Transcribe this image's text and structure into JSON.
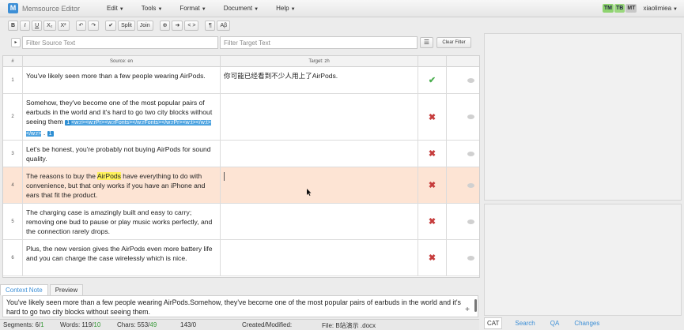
{
  "menubar": {
    "app_name": "Memsource Editor",
    "menus": [
      "Edit",
      "Tools",
      "Format",
      "Document",
      "Help"
    ],
    "badges": [
      "TM",
      "TB",
      "MT"
    ],
    "user": "xiaolimiea"
  },
  "toolbar": {
    "bold": "B",
    "italic": "I",
    "underline": "U",
    "subscript": "X₂",
    "superscript": "X²",
    "undo": "↶",
    "redo": "↷",
    "confirm": "✔",
    "split": "Split",
    "join": "Join",
    "copy_source": "⊕",
    "next": "➜",
    "tags": "< >",
    "pilcrow": "¶",
    "special_chars": "Aβ"
  },
  "filters": {
    "source_placeholder": "Filter Source Text",
    "target_placeholder": "Filter Target Text",
    "list_icon": "☰",
    "clear_label": "Clear Filter"
  },
  "grid": {
    "headers": {
      "num": "#",
      "source": "Source: en",
      "target": "Target: zh"
    },
    "rows": [
      {
        "num": "1",
        "source": "You've likely seen more than a few people wearing AirPods.",
        "target": "你可能已经看到不少人用上了AirPods.",
        "status": "confirmed"
      },
      {
        "num": "2",
        "source_before": "Somehow, they've become one of the most popular pairs of earbuds in the world and it's hard to go two city blocks without seeing them ",
        "tag_open": "1",
        "tag_text": "<w:r><w:rPr><w:rFonts></w:rFonts></w:rPr><w:t></w:t></w:r>",
        "source_after": " . ",
        "tag_close": "1",
        "target": "",
        "status": "unconfirmed"
      },
      {
        "num": "3",
        "source": "Let's be honest, you're probably not buying AirPods for sound quality.",
        "target": "",
        "status": "unconfirmed"
      },
      {
        "num": "4",
        "source_before": "The reasons to buy the ",
        "highlight": "AirPods",
        "source_after": " have everything to do with convenience, but that only works if you have an iPhone and ears that fit the product.",
        "target": "",
        "status": "unconfirmed"
      },
      {
        "num": "5",
        "source": "The charging case is amazingly built and easy to carry; removing one bud to pause or play music works perfectly, and the connection rarely drops.",
        "target": "",
        "status": "unconfirmed"
      },
      {
        "num": "6",
        "source": "Plus, the new version gives the AirPods even more battery life and you can charge the case wirelessly which is nice.",
        "target": "",
        "status": "unconfirmed"
      }
    ]
  },
  "bottom_tabs": [
    "Context Note",
    "Preview"
  ],
  "context_text": "You've likely seen more than a few people wearing AirPods.Somehow, they've become one of the most popular pairs of earbuds in the world and it's hard to go two city blocks without seeing them.",
  "statusbar": {
    "segments_label": "Segments: ",
    "segments_value": "6",
    "segments_done": "1",
    "words_label": "Words: ",
    "words_value": "119",
    "words_done": "10",
    "chars_label": "Chars: ",
    "chars_value": "553",
    "chars_done": "49",
    "ratio": "143/0",
    "created_label": "Created/Modified:",
    "file_label": "File: B站演示 .docx"
  },
  "right_tabs": [
    "CAT",
    "Search",
    "QA",
    "Changes"
  ],
  "colors": {
    "accent": "#3d8fd6",
    "active_row": "#fde4d4",
    "confirmed": "#4caf50",
    "unconfirmed": "#c63c3c"
  }
}
